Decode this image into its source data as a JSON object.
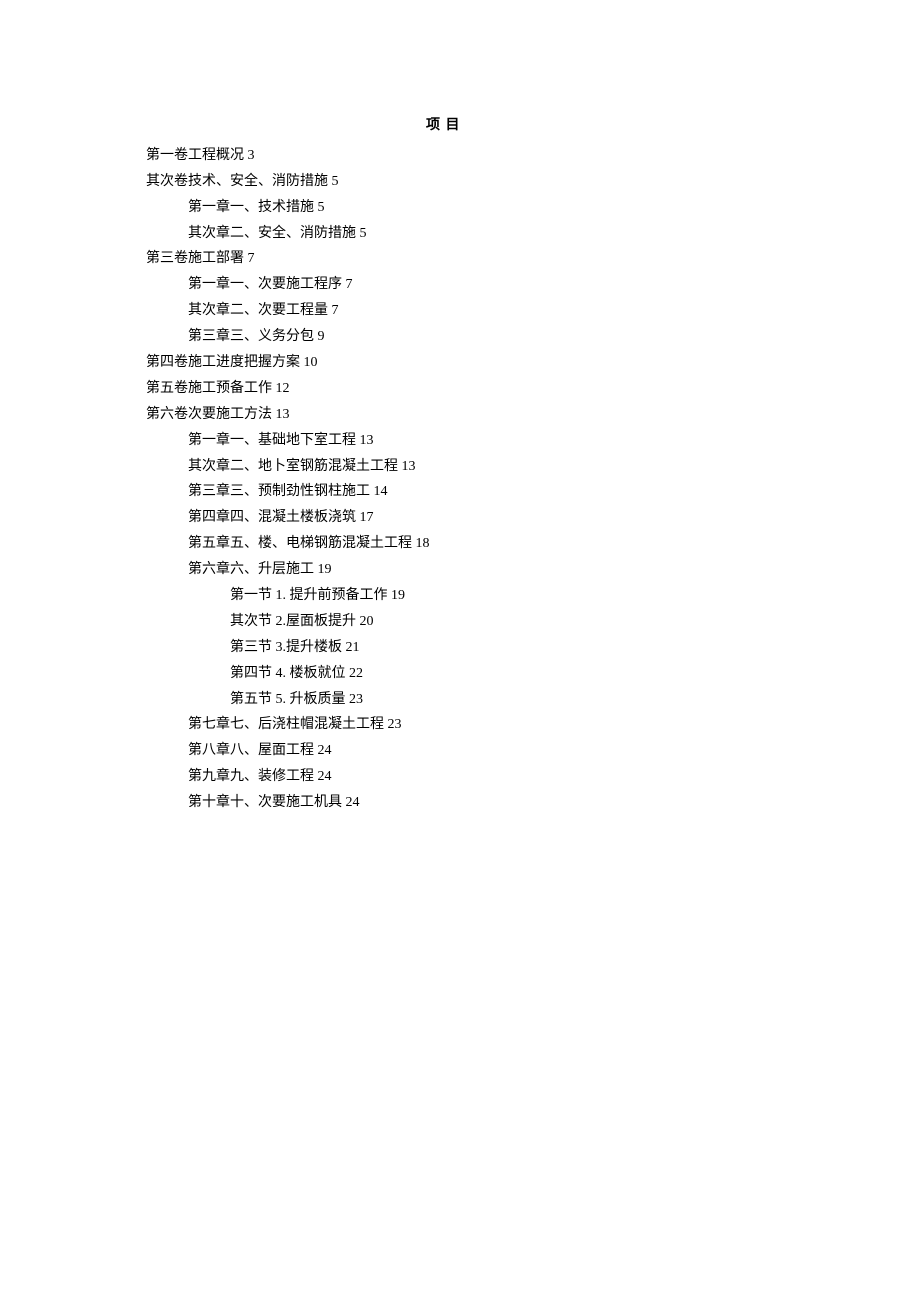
{
  "title": "项 目",
  "toc": [
    {
      "level": 1,
      "text": "第一卷工程概况 3"
    },
    {
      "level": 1,
      "text": "其次卷技术、安全、消防措施 5"
    },
    {
      "level": 2,
      "text": "第一章一、技术措施 5"
    },
    {
      "level": 2,
      "text": "其次章二、安全、消防措施 5"
    },
    {
      "level": 1,
      "text": "第三卷施工部署 7"
    },
    {
      "level": 2,
      "text": "第一章一、次要施工程序 7"
    },
    {
      "level": 2,
      "text": "其次章二、次要工程量 7"
    },
    {
      "level": 2,
      "text": "第三章三、义务分包 9"
    },
    {
      "level": 1,
      "text": "第四卷施工进度把握方案 10"
    },
    {
      "level": 1,
      "text": "第五卷施工预备工作 12"
    },
    {
      "level": 1,
      "text": "第六卷次要施工方法 13"
    },
    {
      "level": 2,
      "text": "第一章一、基础地下室工程 13"
    },
    {
      "level": 2,
      "text": "其次章二、地卜室钢筋混凝土工程 13"
    },
    {
      "level": 2,
      "text": "第三章三、预制劲性钢柱施工 14"
    },
    {
      "level": 2,
      "text": "第四章四、混凝土楼板浇筑 17"
    },
    {
      "level": 2,
      "text": "第五章五、楼、电梯钢筋混凝土工程 18"
    },
    {
      "level": 2,
      "text": "第六章六、升层施工 19"
    },
    {
      "level": 3,
      "text": "第一节 1. 提升前预备工作 19"
    },
    {
      "level": 3,
      "text": "其次节 2.屋面板提升 20"
    },
    {
      "level": 3,
      "text": "第三节 3.提升楼板 21"
    },
    {
      "level": 3,
      "text": "第四节 4. 楼板就位 22"
    },
    {
      "level": 3,
      "text": "第五节 5. 升板质量 23"
    },
    {
      "level": 2,
      "text": "第七章七、后浇柱帽混凝土工程 23"
    },
    {
      "level": 2,
      "text": "第八章八、屋面工程 24"
    },
    {
      "level": 2,
      "text": "第九章九、装修工程 24"
    },
    {
      "level": 2,
      "text": "第十章十、次要施工机具 24"
    }
  ]
}
